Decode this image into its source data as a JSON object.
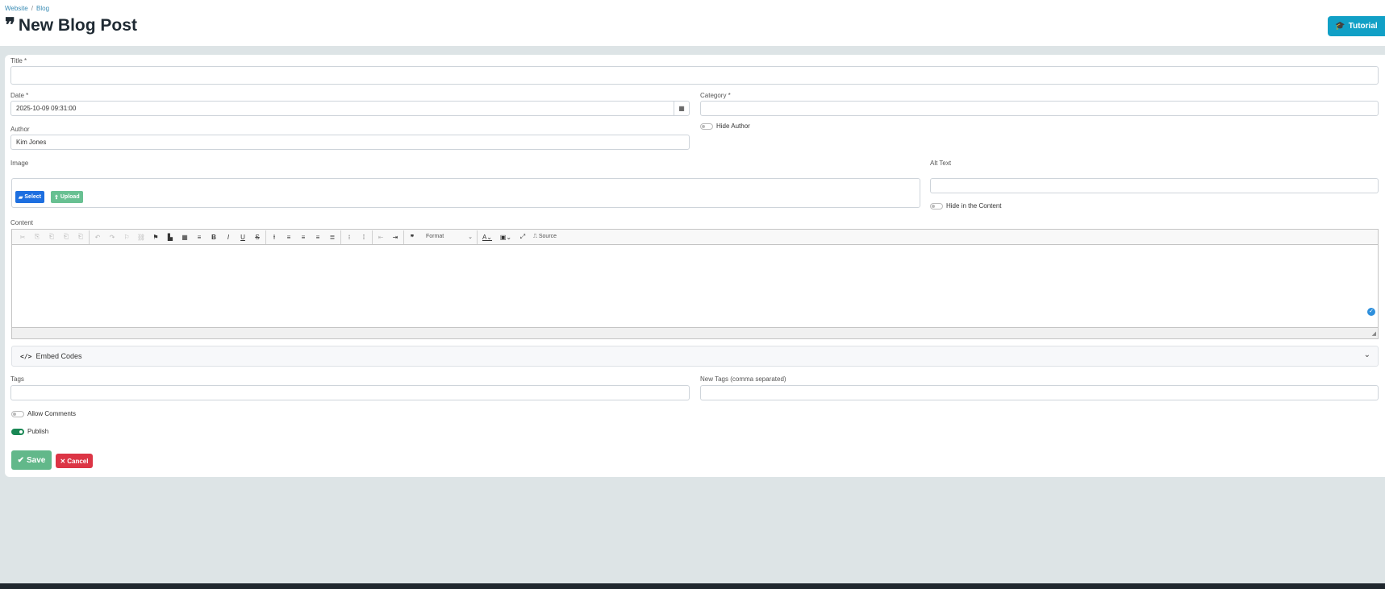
{
  "breadcrumb": {
    "items": [
      "Website",
      "Blog"
    ],
    "separator": "/"
  },
  "header": {
    "title": "New Blog Post",
    "title_icon": "quote-icon",
    "tutorial_label": "Tutorial"
  },
  "form": {
    "title_label": "Title *",
    "title_value": "",
    "date_label": "Date *",
    "date_value": "2025-10-09 09:31:00",
    "category_label": "Category *",
    "category_value": "",
    "author_label": "Author",
    "author_value": "Kim Jones",
    "hide_author_label": "Hide Author",
    "hide_author_on": false,
    "image_label": "Image",
    "select_label": "Select",
    "upload_label": "Upload",
    "alt_text_label": "Alt Text",
    "alt_text_value": "",
    "hide_in_content_label": "Hide in the Content",
    "hide_in_content_on": false,
    "content_label": "Content",
    "editor": {
      "format_label": "Format",
      "source_label": "Source"
    },
    "embed_label": "Embed Codes",
    "tags_label": "Tags",
    "new_tags_label": "New Tags (comma separated)",
    "allow_comments_label": "Allow Comments",
    "allow_comments_on": false,
    "publish_label": "Publish",
    "publish_on": true,
    "save_label": "Save",
    "cancel_label": "Cancel"
  },
  "colors": {
    "accent": "#11a0c6",
    "save": "#62b88a",
    "cancel": "#dc3545",
    "select": "#1d6fe0",
    "toggle_on": "#198754"
  }
}
